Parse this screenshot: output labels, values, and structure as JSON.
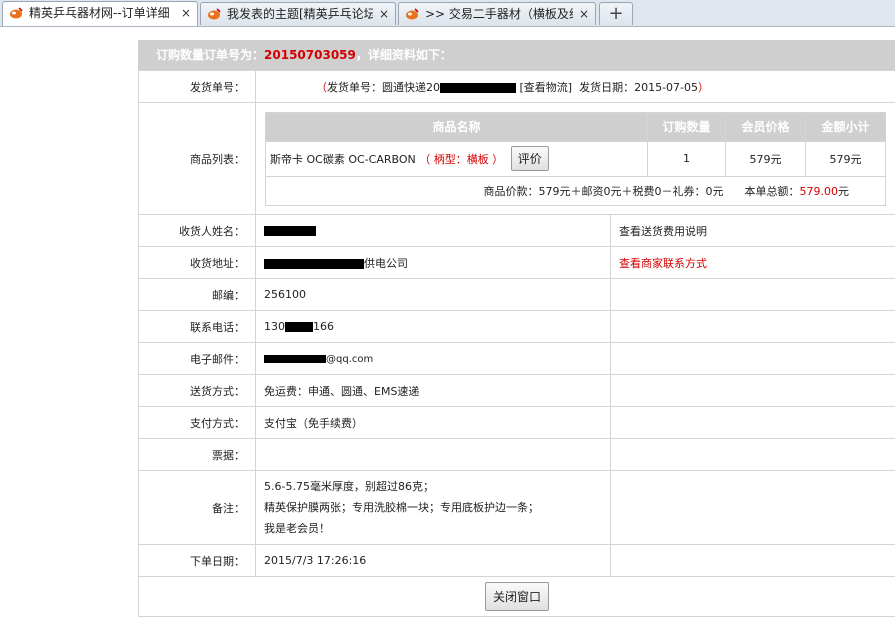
{
  "tabs": [
    {
      "title": "精英乒乓器材网--订单详细",
      "close": "×"
    },
    {
      "title": "我发表的主题[精英乒乓论坛",
      "close": "×"
    },
    {
      "title": ">> 交易二手器材（横板及组",
      "close": "×"
    }
  ],
  "new_tab": "+",
  "order": {
    "header_prefix": "订购数量订单号为：",
    "order_no": "20150703059",
    "header_suffix": "，详细资料如下：",
    "shipping": {
      "label": "发货单号：",
      "open_paren": "（",
      "prefix": "发货单号：圆通快递20",
      "link": "[查看物流]",
      "date_label": "发货日期：2015-07-05",
      "close_paren": "）"
    },
    "products": {
      "label": "商品列表：",
      "columns": [
        "商品名称",
        "订购数量",
        "会员价格",
        "金额小计"
      ],
      "item": {
        "name": "斯帝卡 OC碳素 OC-CARBON",
        "variant": "（ 柄型：横板 ）",
        "review_button": "评价",
        "qty": "1",
        "price": "579元",
        "subtotal": "579元"
      },
      "summary": "商品价款：579元＋邮资0元＋税费0－礼券：0元",
      "total_label": "本单总额：",
      "total_value": "579.00",
      "total_unit": "元"
    },
    "rows": {
      "name_label": "收货人姓名：",
      "shipping_fee_note": "查看送货费用说明",
      "address_label": "收货地址：",
      "address_suffix": "供电公司",
      "merchant_contact": "查看商家联系方式",
      "zip_label": "邮编：",
      "zip": "256100",
      "phone_label": "联系电话：",
      "phone_prefix": "130",
      "phone_suffix": "166",
      "email_label": "电子邮件：",
      "email_suffix": "@qq.com",
      "delivery_label": "送货方式：",
      "delivery": "免运费：申通、圆通、EMS速递",
      "payment_label": "支付方式：",
      "payment": "支付宝（免手续费）",
      "invoice_label": "票据：",
      "note_label": "备注：",
      "note_lines": [
        "5.6-5.75毫米厚度，别超过86克；",
        "精英保护膜两张；专用洗胶棉一块；专用底板护边一条；",
        "我是老会员！"
      ],
      "date_label": "下单日期：",
      "date": "2015/7/3 17:26:16"
    },
    "close_button": "关闭窗口"
  }
}
